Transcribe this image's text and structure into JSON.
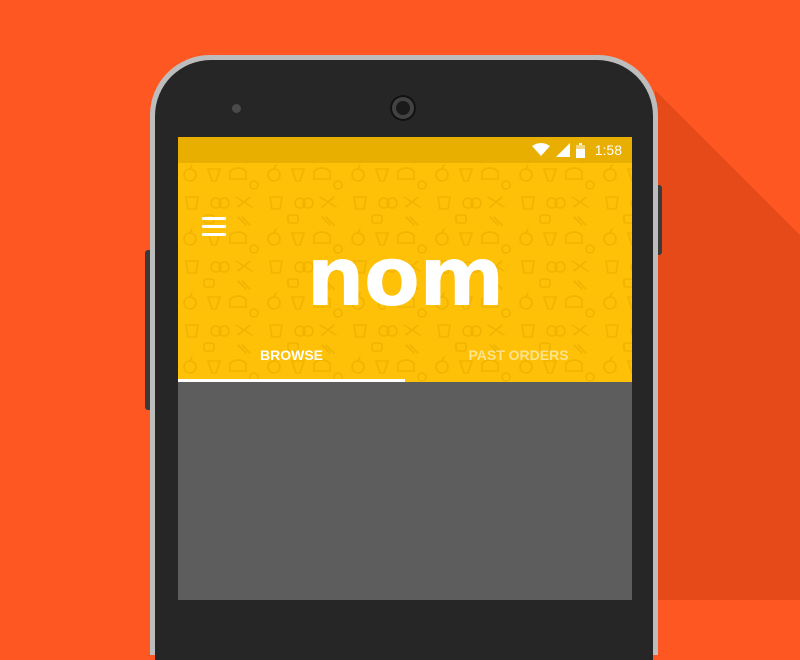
{
  "colors": {
    "background": "#ff5722",
    "header": "#ffc107",
    "status_bar": "#e8af00",
    "content": "#5d5d5d",
    "phone_body": "#262626"
  },
  "status_bar": {
    "icons": [
      "wifi-icon",
      "cell-signal-icon",
      "battery-icon"
    ],
    "time": "1:58"
  },
  "header": {
    "menu_icon": "menu-icon",
    "logo": "nom"
  },
  "tabs": [
    {
      "label": "BROWSE",
      "active": true
    },
    {
      "label": "PAST ORDERS",
      "active": false
    }
  ]
}
